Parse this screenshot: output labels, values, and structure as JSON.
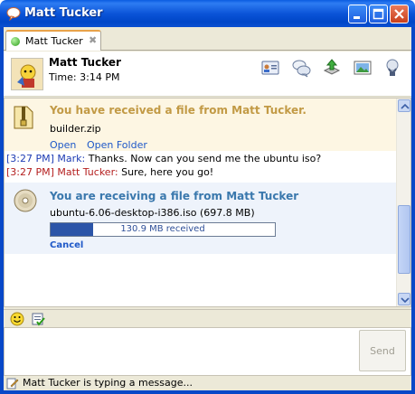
{
  "window": {
    "title": "Matt Tucker"
  },
  "tabs": [
    {
      "label": "Matt Tucker",
      "close_glyph": "✖"
    }
  ],
  "contact": {
    "name": "Matt Tucker",
    "time": "Time: 3:14 PM"
  },
  "header_icons": [
    "contact-card-icon",
    "chat-bubbles-icon",
    "send-file-icon",
    "screenshot-icon",
    "phone-icon"
  ],
  "transfer_received": {
    "title": "You have received a file from Matt Tucker.",
    "filename": "builder.zip",
    "open_label": "Open",
    "open_folder_label": "Open Folder"
  },
  "messages": [
    {
      "time": "[3:27 PM]",
      "sender": "Mark:",
      "text": " Thanks. Now can you send me the ubuntu iso?",
      "color": "#1e3cb4"
    },
    {
      "time": "[3:27 PM]",
      "sender": "Matt Tucker:",
      "text": " Sure, here you go!",
      "color": "#b41e1e"
    }
  ],
  "transfer_receiving": {
    "title": "You are receiving a file from Matt Tucker",
    "filename": "ubuntu-6.06-desktop-i386.iso (697.8 MB)",
    "progress_text": "130.9 MB received",
    "progress_fraction": 0.188,
    "cancel_label": "Cancel"
  },
  "input": {
    "send_label": "Send"
  },
  "status": {
    "text": "Matt Tucker is typing a message..."
  },
  "colors": {
    "titlebar": "#0b54d8",
    "accent_link": "#1e58c8",
    "transfer_title_gold": "#c29a45",
    "transfer_title_blue": "#3a78ad",
    "progress_fill": "#2c55a8"
  }
}
